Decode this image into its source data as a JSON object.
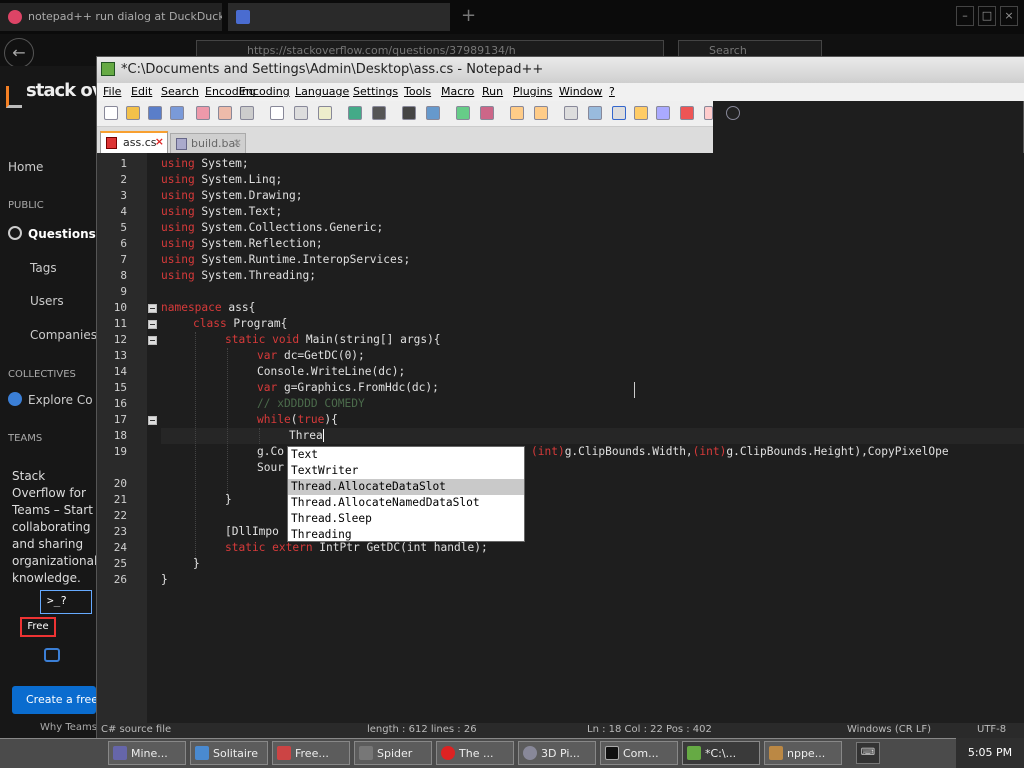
{
  "browser": {
    "tabs": [
      {
        "label": "notepad++ run dialog at DuckDuckGo"
      },
      {
        "label": ""
      }
    ],
    "new_tab_icon": "+",
    "back_icon": "←",
    "url": "https://stackoverflow.com/questions/37989134/h",
    "search_placeholder": "Search"
  },
  "stackoverflow": {
    "logo_text": "stack ov",
    "nav": {
      "home": "Home",
      "public": "PUBLIC",
      "questions": "Questions",
      "tags": "Tags",
      "users": "Users",
      "companies": "Companies",
      "collectives": "COLLECTIVES",
      "explore": "Explore Co",
      "teams": "TEAMS"
    },
    "teams_text": "Stack Overflow for Teams – Start collaborating and sharing organizational knowledge.",
    "free_badge": "Free",
    "create_button": "Create a free Team",
    "why_link": "Why Teams?"
  },
  "notepad": {
    "title": "*C:\\Documents and Settings\\Admin\\Desktop\\ass.cs - Notepad++",
    "menu": [
      "File",
      "Edit",
      "Search",
      "Encoding",
      "Language",
      "Settings",
      "Tools",
      "Macro",
      "Run",
      "Plugins",
      "Window",
      "?"
    ],
    "tabs": [
      {
        "label": "ass.cs",
        "active": true
      },
      {
        "label": "build.bat",
        "active": false
      }
    ],
    "close_glyph": "×",
    "line_numbers": [
      "1",
      "2",
      "3",
      "4",
      "5",
      "6",
      "7",
      "8",
      "9",
      "10",
      "11",
      "12",
      "13",
      "14",
      "15",
      "16",
      "17",
      "18",
      "19",
      "20",
      "21",
      "22",
      "23",
      "24",
      "25",
      "26"
    ],
    "code": {
      "l1_kw": "using",
      "l1": " System;",
      "l2_kw": "using",
      "l2": " System.Linq;",
      "l3_kw": "using",
      "l3": " System.Drawing;",
      "l4_kw": "using",
      "l4": " System.Text;",
      "l5_kw": "using",
      "l5": " System.Collections.Generic;",
      "l6_kw": "using",
      "l6": " System.Reflection;",
      "l7_kw": "using",
      "l7": " System.Runtime.InteropServices;",
      "l8_kw": "using",
      "l8": " System.Threading;",
      "l10_kw": "namespace",
      "l10": " ass{",
      "l11_kw": "class",
      "l11": " Program{",
      "l12_kw": "static void",
      "l12": " Main(string[] args){",
      "l13_kw": "var",
      "l13": " dc=GetDC(0);",
      "l14": "Console.WriteLine(dc);",
      "l15_kw": "var",
      "l15": " g=Graphics.FromHdc(dc);",
      "l16": "// xDDDDD COMEDY",
      "l17_kw": "while",
      "l17a": "(",
      "l17_kw2": "true",
      "l17b": "){",
      "l18": "Threa",
      "l19a": "g.Co",
      "l19b": "(int)",
      "l19c": "g.ClipBounds.Width,",
      "l19d": "(int)",
      "l19e": "g.ClipBounds.Height),CopyPixelOpe",
      "l20": "Sour",
      "l21": "}",
      "l23": "[DllImpo",
      "l24_kw": "static extern",
      "l24": " IntPtr GetDC(int handle);",
      "l25": "}",
      "l26": "}"
    },
    "autocomplete": [
      {
        "label": "Text",
        "selected": false
      },
      {
        "label": "TextWriter",
        "selected": false
      },
      {
        "label": "Thread.AllocateDataSlot",
        "selected": true
      },
      {
        "label": "Thread.AllocateNamedDataSlot",
        "selected": false
      },
      {
        "label": "Thread.Sleep",
        "selected": false
      },
      {
        "label": "Threading",
        "selected": false
      }
    ],
    "status": {
      "left": "C# source file",
      "length": "length : 612    lines : 26",
      "pos": "Ln : 18    Col : 22    Pos : 402",
      "eol": "Windows (CR LF)",
      "enc": "UTF-8"
    }
  },
  "taskbar": {
    "tasks": [
      {
        "label": "Mine..."
      },
      {
        "label": "Solitaire"
      },
      {
        "label": "Free..."
      },
      {
        "label": "Spider"
      },
      {
        "label": "The ..."
      },
      {
        "label": "3D Pi..."
      },
      {
        "label": "Com..."
      },
      {
        "label": "*C:\\..."
      },
      {
        "label": "nppe..."
      }
    ],
    "clock": "5:05 PM"
  }
}
